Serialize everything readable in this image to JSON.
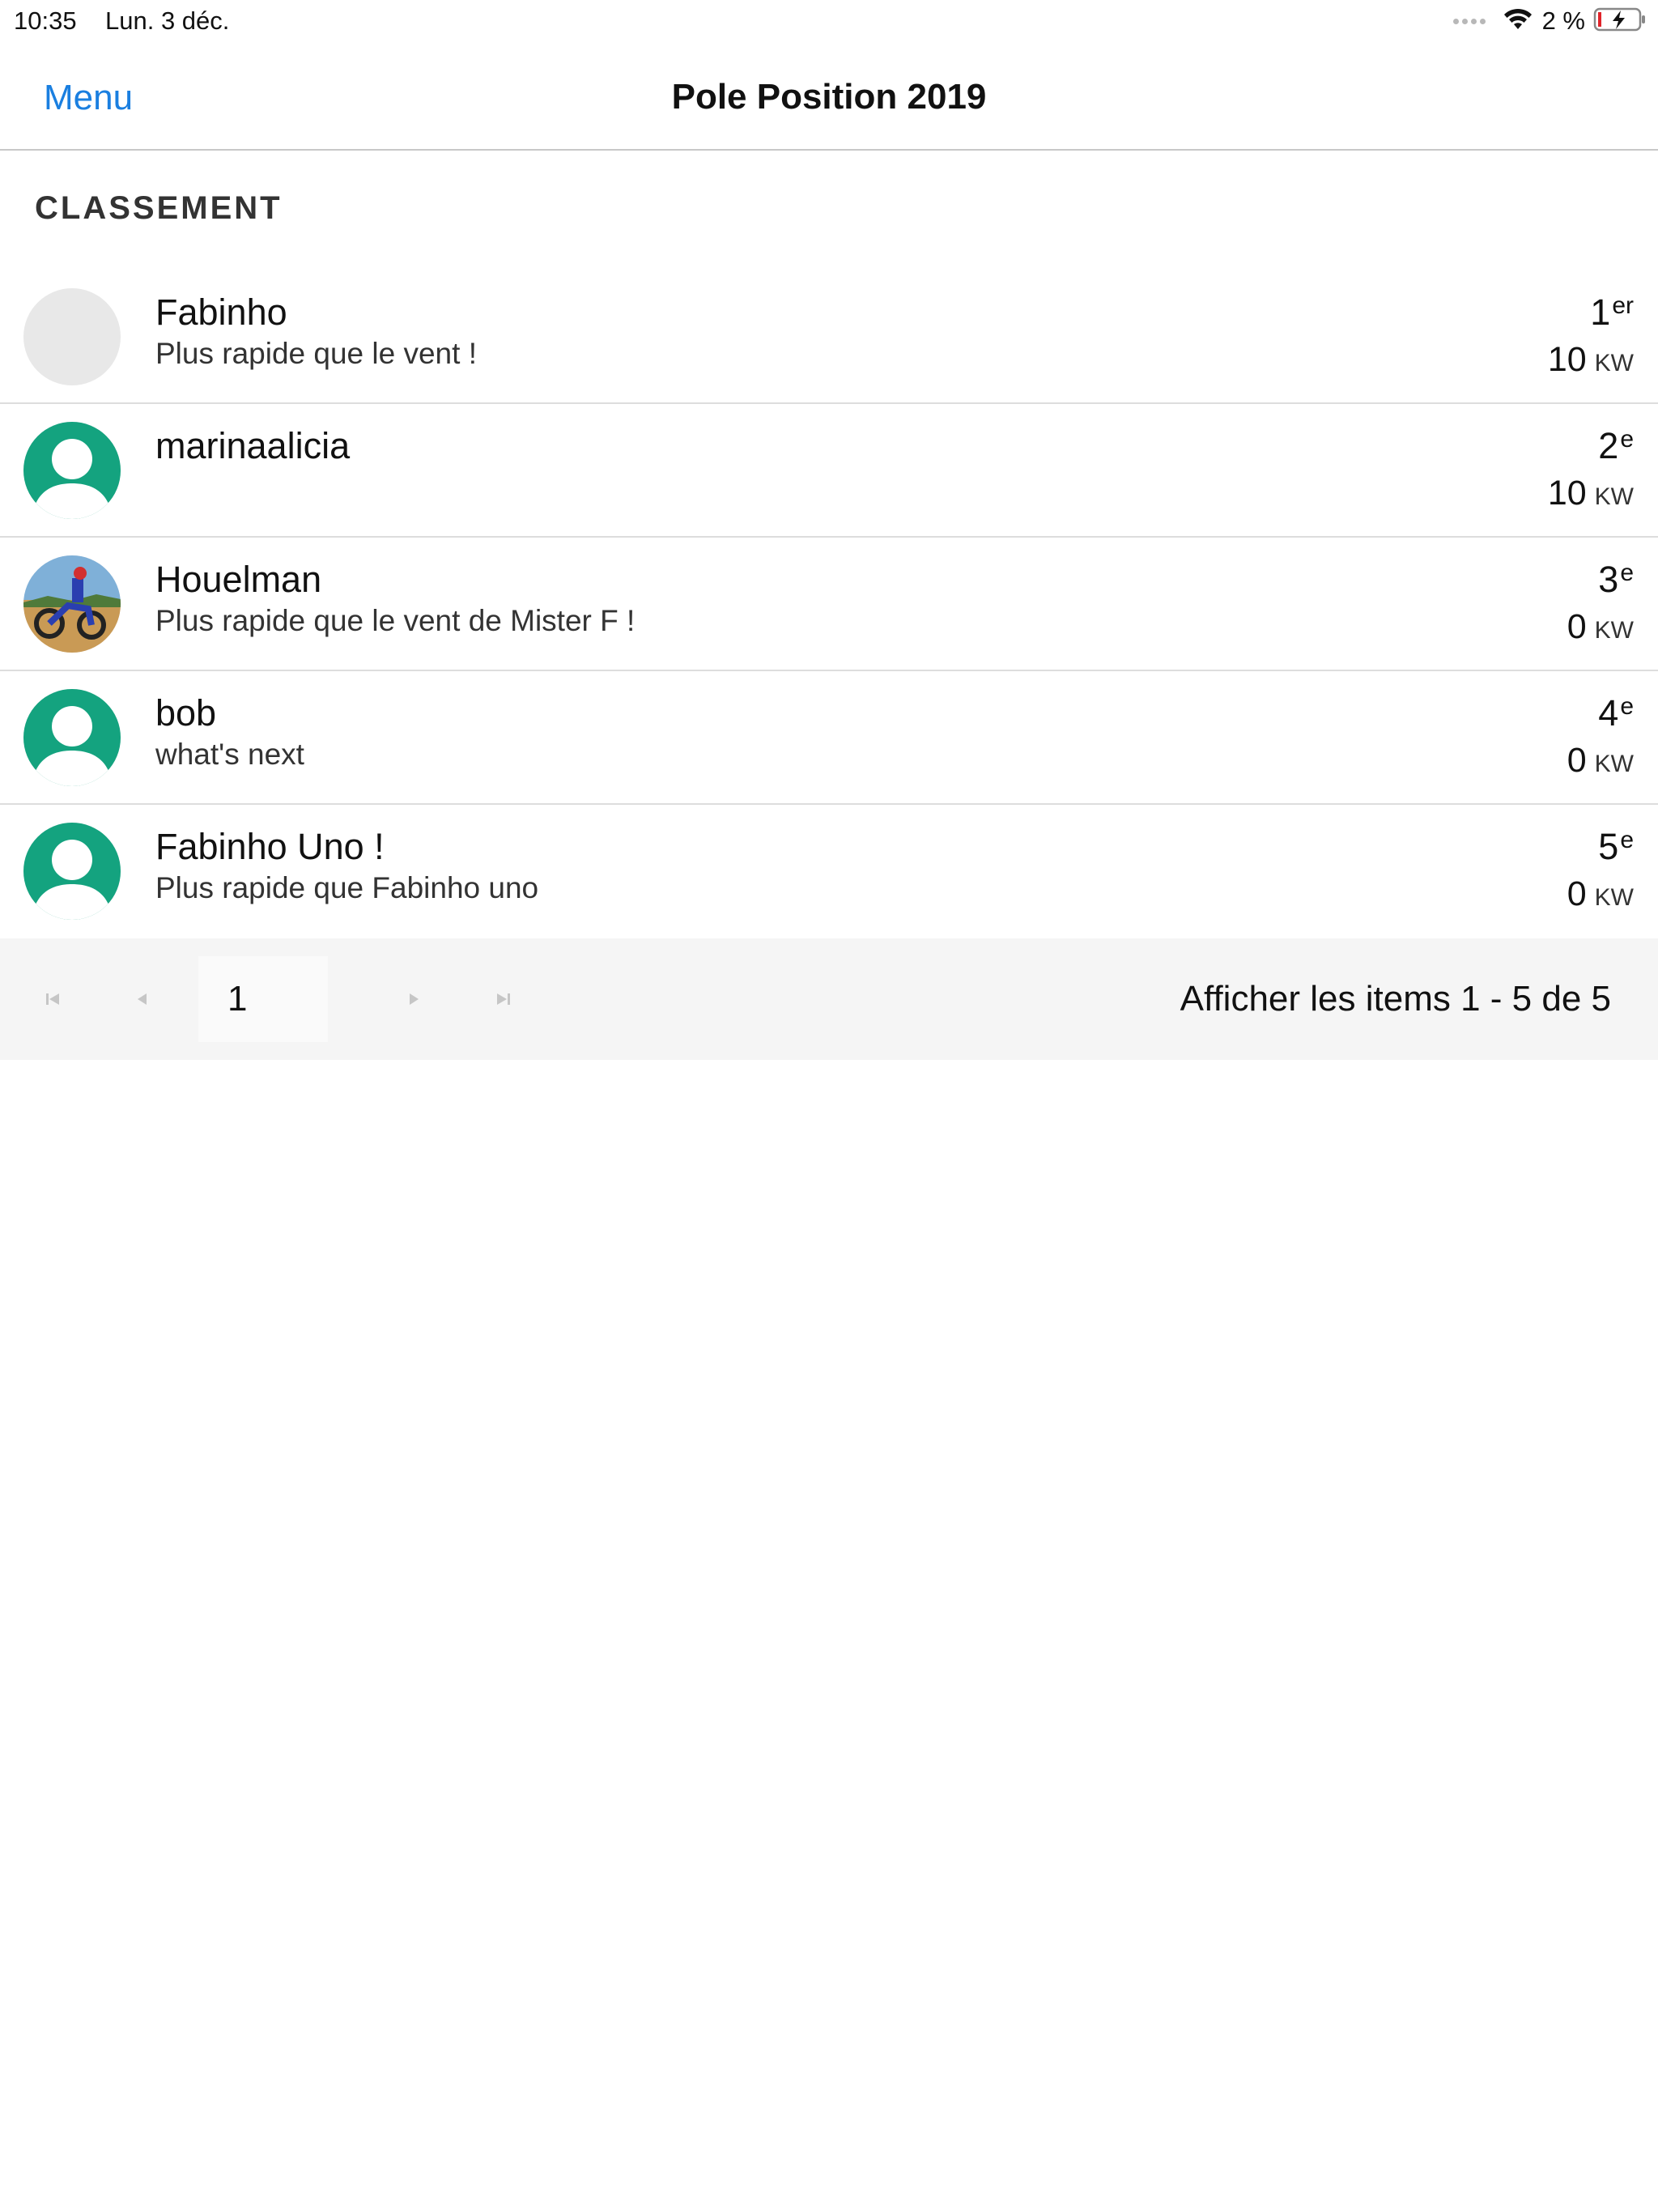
{
  "status_bar": {
    "time": "10:35",
    "date": "Lun. 3 déc.",
    "battery_percent": "2 %",
    "wifi_icon": "wifi-icon",
    "battery_icon": "battery-charging-icon"
  },
  "nav": {
    "menu_label": "Menu",
    "title": "Pole Position 2019",
    "accent_color": "#1a7fe0"
  },
  "section": {
    "heading": "CLASSEMENT"
  },
  "ranking": [
    {
      "name": "Fabinho",
      "subtitle": "Plus rapide que le vent !",
      "rank": "1",
      "rank_suffix": "er",
      "score": "10",
      "unit": "KW",
      "avatar": "blank"
    },
    {
      "name": "marinaalicia",
      "subtitle": "",
      "rank": "2",
      "rank_suffix": "e",
      "score": "10",
      "unit": "KW",
      "avatar": "default-user"
    },
    {
      "name": "Houelman",
      "subtitle": "Plus rapide que le vent de Mister F !",
      "rank": "3",
      "rank_suffix": "e",
      "score": "0",
      "unit": "KW",
      "avatar": "photo"
    },
    {
      "name": "bob",
      "subtitle": "what's next",
      "rank": "4",
      "rank_suffix": "e",
      "score": "0",
      "unit": "KW",
      "avatar": "default-user"
    },
    {
      "name": "Fabinho Uno !",
      "subtitle": "Plus rapide que Fabinho uno",
      "rank": "5",
      "rank_suffix": "e",
      "score": "0",
      "unit": "KW",
      "avatar": "default-user"
    }
  ],
  "avatar_colors": {
    "default_user_bg": "#14a37f",
    "blank_bg": "#e8e8e8"
  },
  "pager": {
    "current_page": "1",
    "info": "Afficher les items 1 - 5 de 5",
    "icons": [
      "first-page-icon",
      "previous-page-icon",
      "next-page-icon",
      "last-page-icon"
    ]
  }
}
